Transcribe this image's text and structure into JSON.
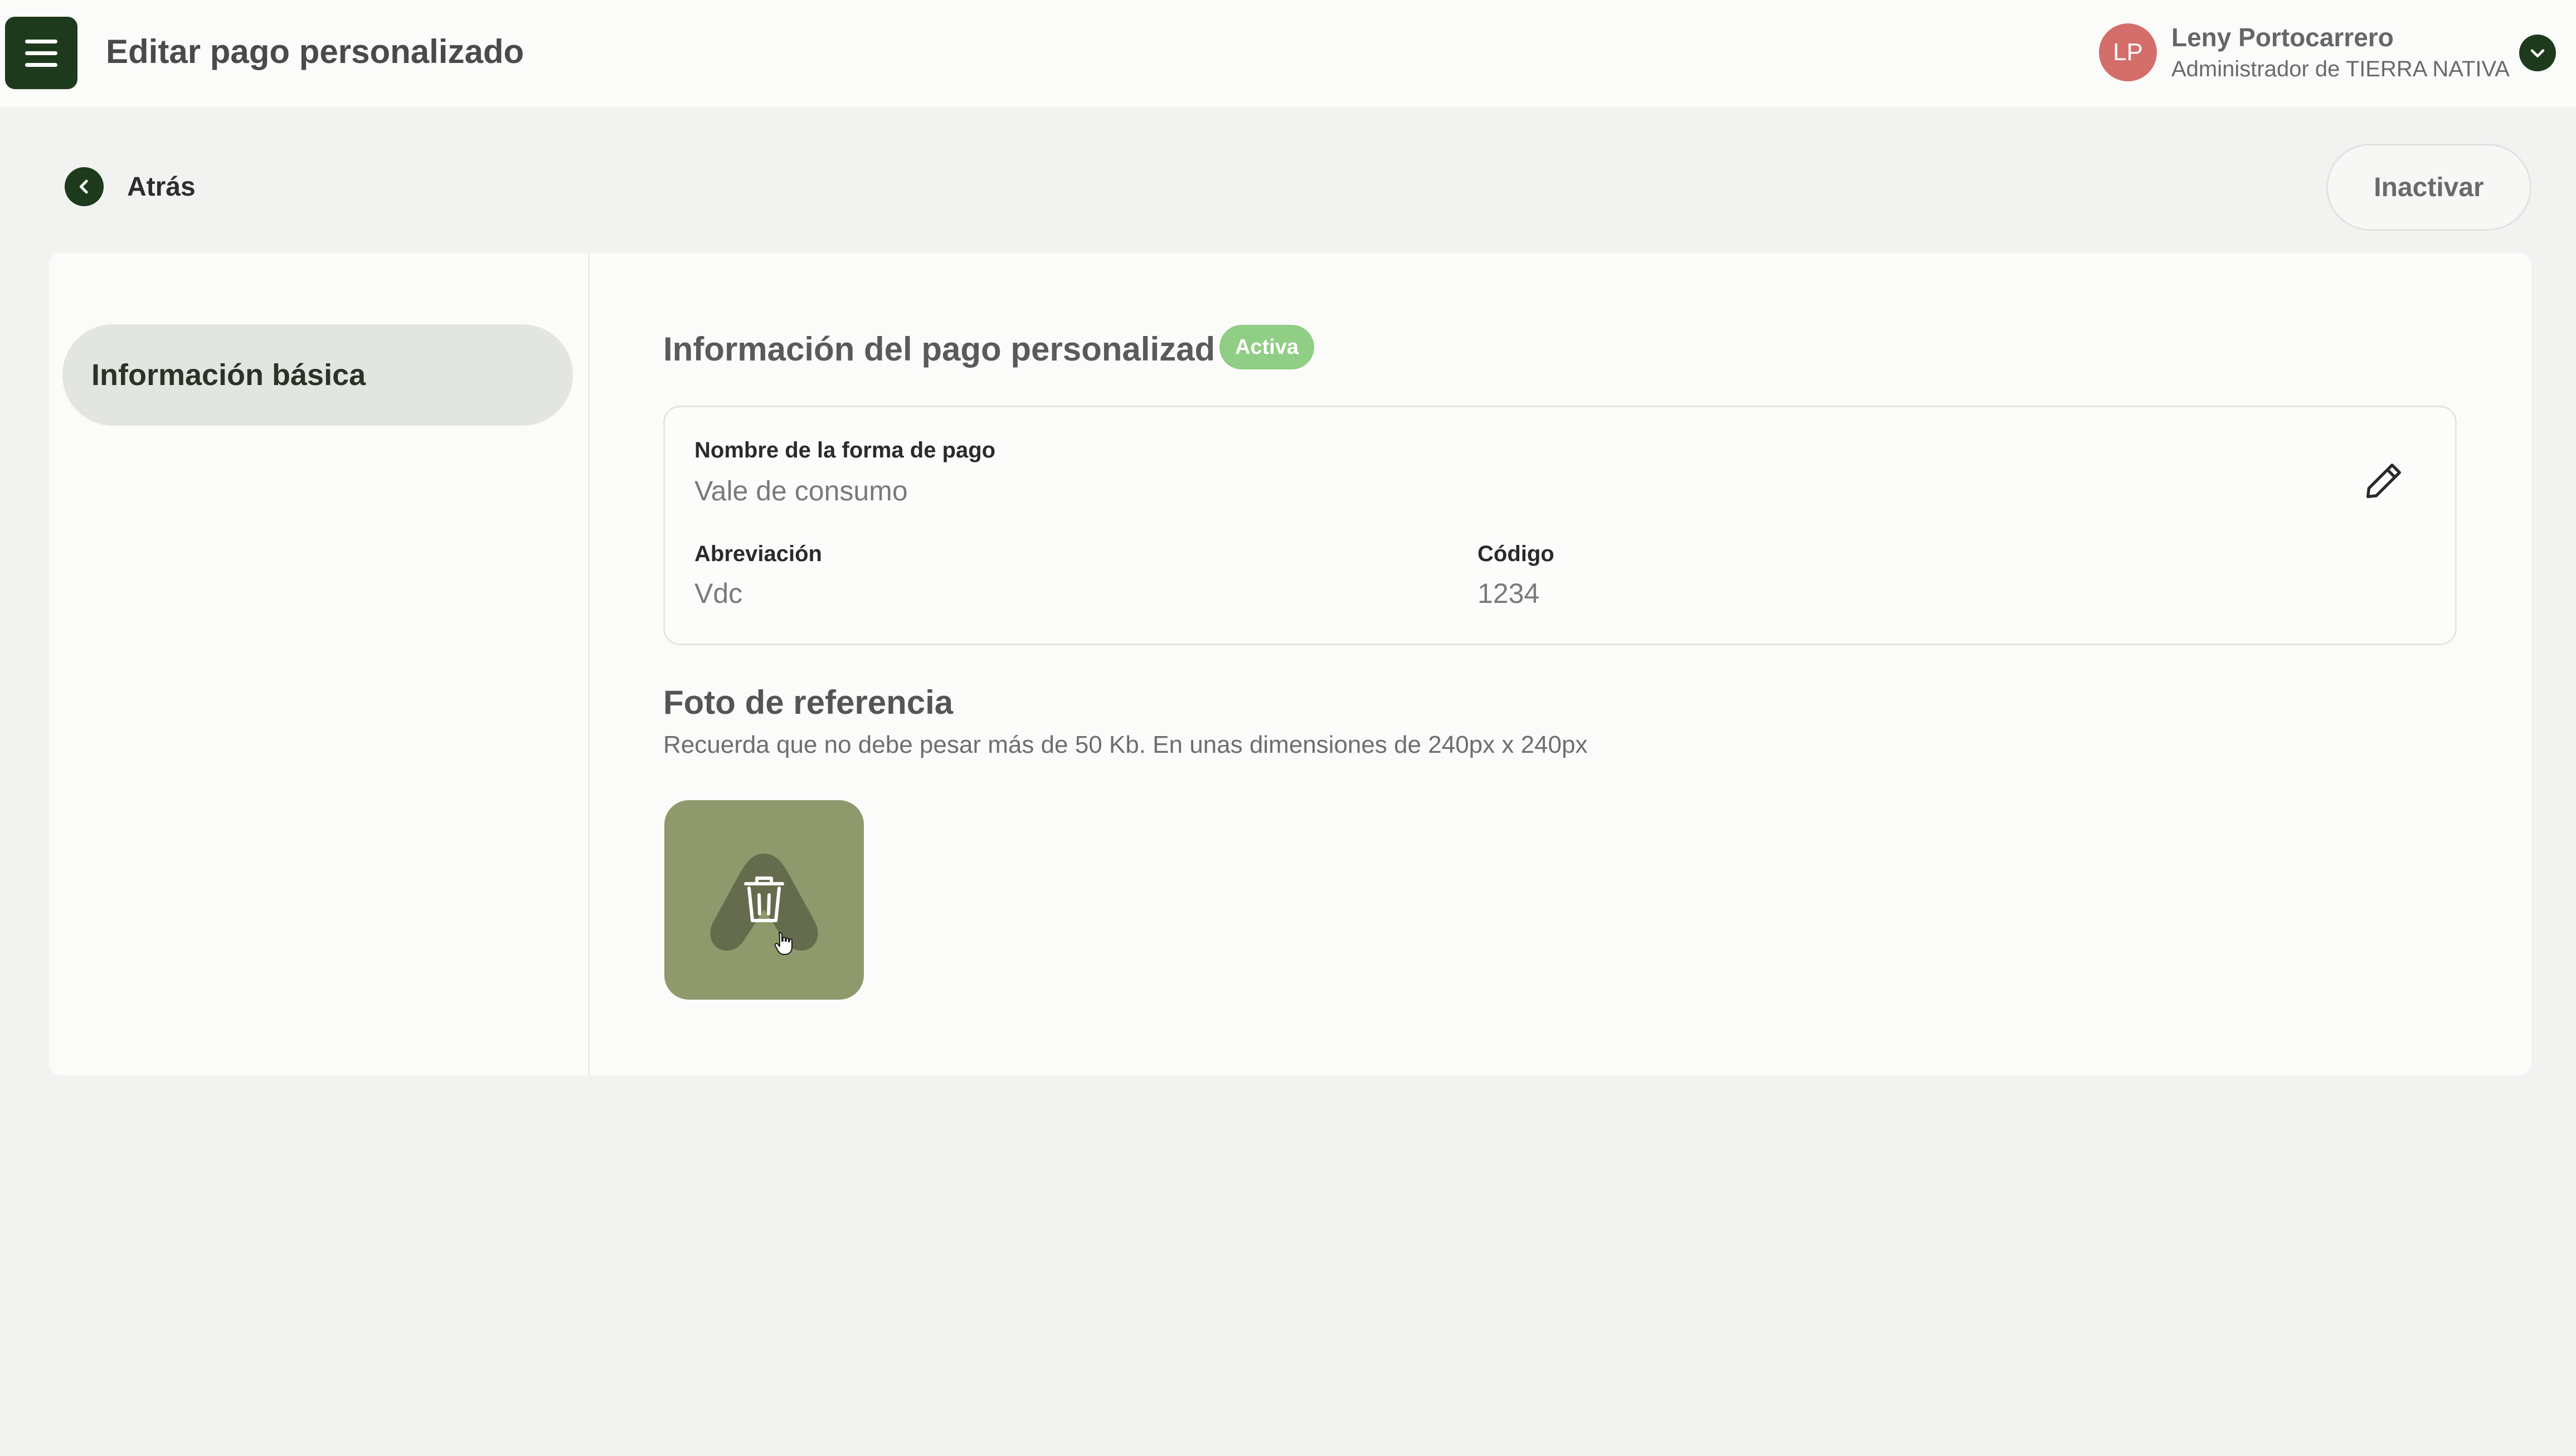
{
  "header": {
    "title": "Editar pago personalizado",
    "user": {
      "initials": "LP",
      "name": "Leny Portocarrero",
      "role": "Administrador de TIERRA NATIVA"
    }
  },
  "toolbar": {
    "back_label": "Atrás",
    "inactivate_label": "Inactivar"
  },
  "sidebar": {
    "items": [
      {
        "label": "Información básica",
        "active": true
      }
    ]
  },
  "section": {
    "title": "Información del pago personalizad",
    "status_badge": "Activa"
  },
  "payment_info": {
    "name_label": "Nombre de la forma de pago",
    "name_value": "Vale de consumo",
    "abbr_label": "Abreviación",
    "abbr_value": "Vdc",
    "code_label": "Código",
    "code_value": "1234"
  },
  "photo": {
    "title": "Foto de referencia",
    "hint": "Recuerda que no debe pesar más de 50 Kb. En unas dimensiones de 240px x 240px"
  },
  "icons": {
    "menu": "hamburger-menu-icon",
    "user_dropdown": "chevron-down-icon",
    "back": "chevron-left-icon",
    "edit": "pencil-icon",
    "delete": "trash-icon",
    "cursor": "hand-pointer-icon"
  },
  "colors": {
    "brand_dark_green": "#1e3a1c",
    "active_badge": "#8fce84",
    "avatar": "#d46e6a",
    "photo_tile": "#8f9a6c",
    "sidebar_active": "#e3e6e0"
  }
}
